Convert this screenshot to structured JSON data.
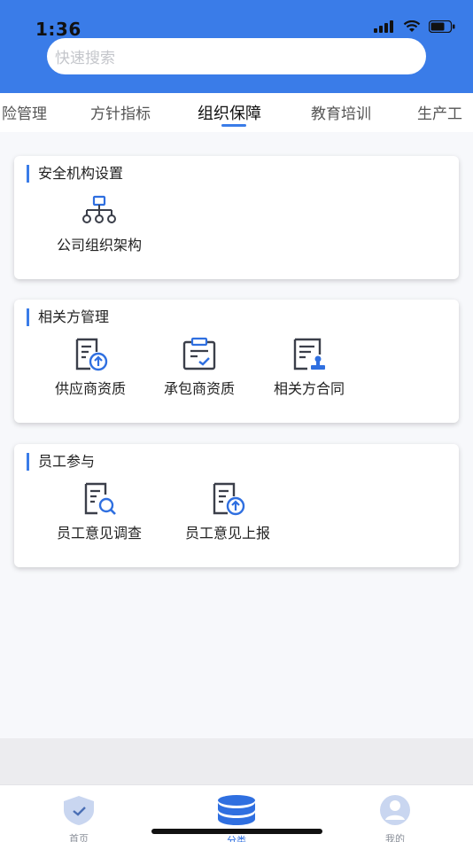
{
  "status": {
    "time": "1:36"
  },
  "search": {
    "placeholder": "快速搜索"
  },
  "tabs": [
    "险管理",
    "方针指标",
    "组织保障",
    "教育培训",
    "生产工"
  ],
  "active_tab": "组织保障",
  "sections": [
    {
      "title": "安全机构设置",
      "items": [
        {
          "label": "公司组织架构",
          "icon": "org-chart-icon"
        }
      ]
    },
    {
      "title": "相关方管理",
      "items": [
        {
          "label": "供应商资质",
          "icon": "document-upload-icon"
        },
        {
          "label": "承包商资质",
          "icon": "clipboard-check-icon"
        },
        {
          "label": "相关方合同",
          "icon": "contract-stamp-icon"
        }
      ]
    },
    {
      "title": "员工参与",
      "items": [
        {
          "label": "员工意见调查",
          "icon": "document-search-icon"
        },
        {
          "label": "员工意见上报",
          "icon": "document-upload-icon"
        }
      ]
    }
  ],
  "tabbar": {
    "items": [
      {
        "label": "首页",
        "icon": "home-shield-icon"
      },
      {
        "label": "分类",
        "icon": "category-stack-icon"
      },
      {
        "label": "我的",
        "icon": "user-avatar-icon"
      }
    ]
  },
  "colors": {
    "accent": "#3a7ce8",
    "icon_dark": "#3b3f4a",
    "icon_blue": "#2f6fe0"
  }
}
